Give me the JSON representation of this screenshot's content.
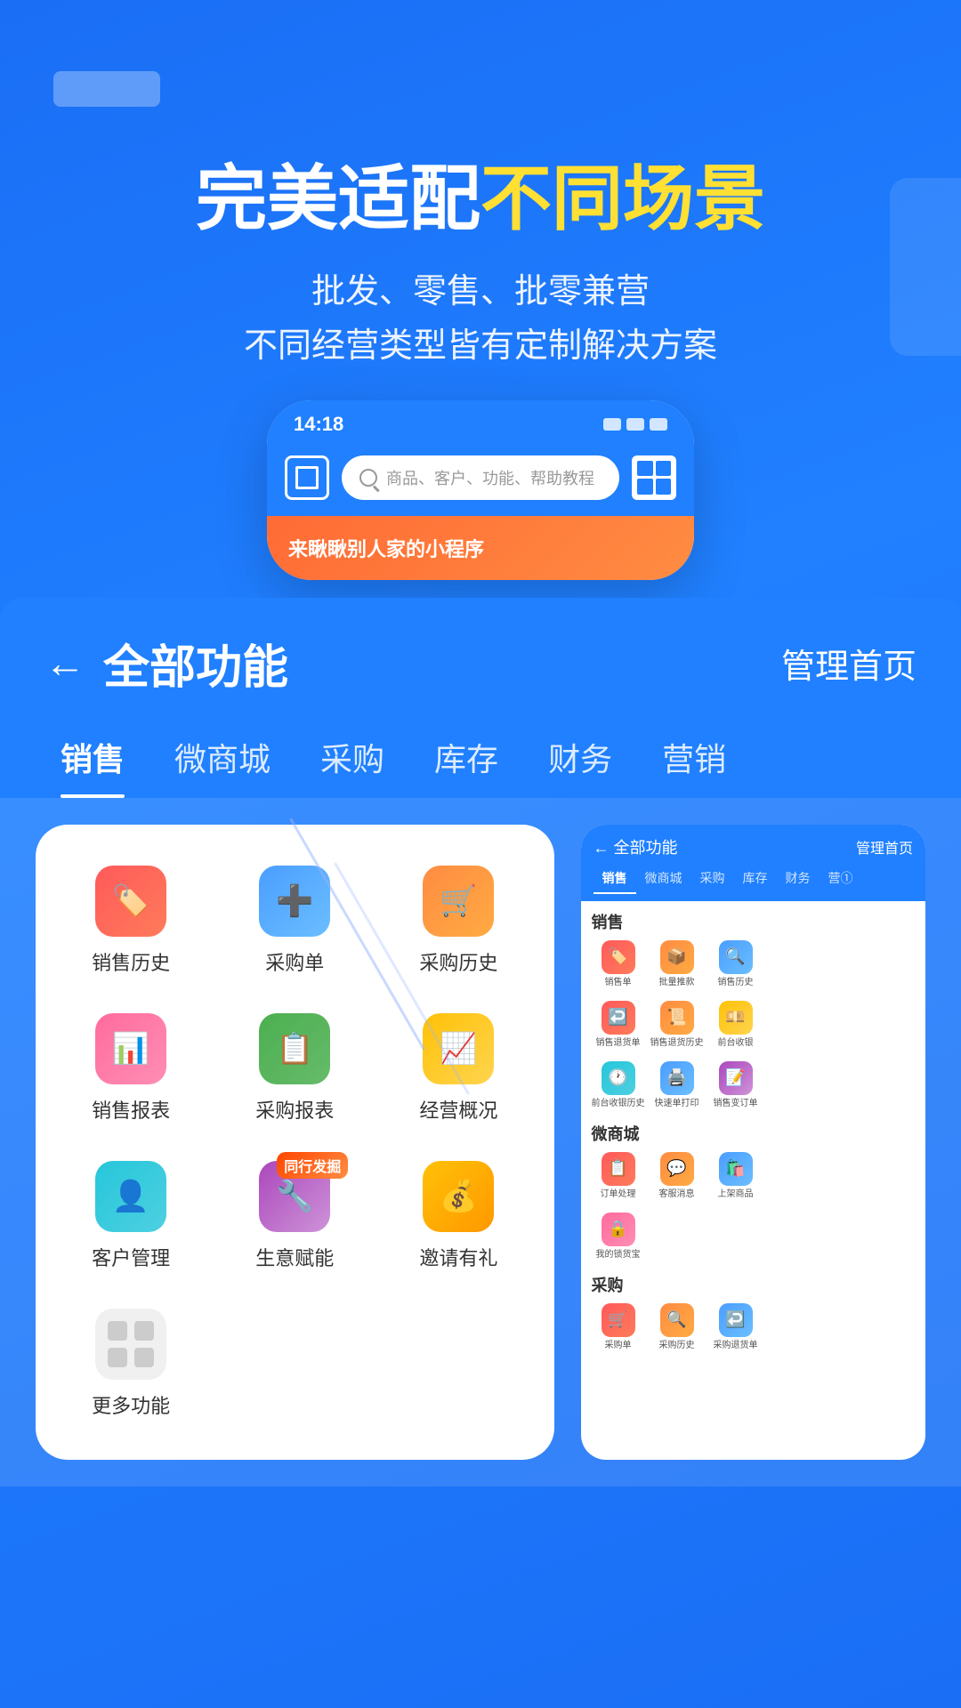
{
  "app": {
    "title": "完美适配不同场景",
    "title_highlight": "不同场景",
    "title_white": "完美适配",
    "subtitle_line1": "批发、零售、批零兼营",
    "subtitle_line2": "不同经营类型皆有定制解决方案"
  },
  "phone": {
    "time": "14:18",
    "search_placeholder": "商品、客户、功能、帮助教程",
    "banner_text": "来瞅瞅别人家的小程序"
  },
  "menu": {
    "back_label": "←",
    "title": "全部功能",
    "right_link": "管理首页",
    "tabs": [
      {
        "label": "销售",
        "active": true
      },
      {
        "label": "微商城",
        "active": false
      },
      {
        "label": "采购",
        "active": false
      },
      {
        "label": "库存",
        "active": false
      },
      {
        "label": "财务",
        "active": false
      },
      {
        "label": "营...",
        "active": false
      }
    ]
  },
  "left_phone": {
    "icons": [
      {
        "label": "销售历史",
        "color": "red",
        "icon": "🏷️"
      },
      {
        "label": "采购单",
        "color": "blue",
        "icon": "➕"
      },
      {
        "label": "采购历史",
        "color": "orange",
        "icon": "🛒"
      },
      {
        "label": "销售报表",
        "color": "pink",
        "icon": "🏷️"
      },
      {
        "label": "采购报表",
        "color": "green",
        "icon": "➕"
      },
      {
        "label": "经营概况",
        "color": "yellow",
        "icon": "📈"
      },
      {
        "label": "客户管理",
        "color": "teal",
        "icon": "👤"
      },
      {
        "label": "生意赋能",
        "color": "purple",
        "icon": "🔧",
        "badge": "同行发掘"
      },
      {
        "label": "邀请有礼",
        "color": "yellow2",
        "icon": "💰"
      },
      {
        "label": "更多功能",
        "color": "gray",
        "icon": "⊞"
      }
    ]
  },
  "right_phone": {
    "header_back": "← 全部功能",
    "header_right": "管理首页",
    "tabs": [
      "销售",
      "微商城",
      "采购",
      "库存",
      "财务",
      "营①"
    ],
    "sections": [
      {
        "title": "销售",
        "icons": [
          {
            "label": "销售单",
            "color": "red"
          },
          {
            "label": "批量推款",
            "color": "orange"
          },
          {
            "label": "销售历史",
            "color": "blue"
          },
          {
            "label": "销售退货单",
            "color": "red2"
          },
          {
            "label": "销售退货历史",
            "color": "orange2"
          },
          {
            "label": "前台收银",
            "color": "yellow"
          },
          {
            "label": "前台收银历史",
            "color": "teal"
          },
          {
            "label": "快速单打印",
            "color": "blue2"
          },
          {
            "label": "销售变订单",
            "color": "purple"
          }
        ]
      },
      {
        "title": "微商城",
        "icons": [
          {
            "label": "订单处理",
            "color": "red"
          },
          {
            "label": "客服消息",
            "color": "orange"
          },
          {
            "label": "上架商品",
            "color": "blue"
          },
          {
            "label": "我的锁货宝",
            "color": "pink"
          }
        ]
      },
      {
        "title": "采购",
        "icons": [
          {
            "label": "采购单",
            "color": "red"
          },
          {
            "label": "采购历史",
            "color": "orange"
          },
          {
            "label": "采购退货单",
            "color": "blue"
          }
        ]
      }
    ]
  }
}
